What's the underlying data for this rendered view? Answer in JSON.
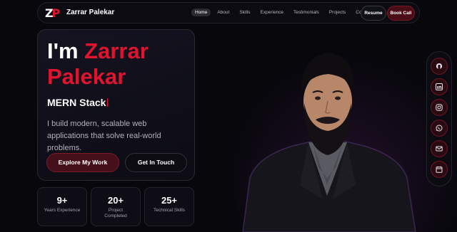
{
  "nav": {
    "logo_z": "Z",
    "logo_p": "P",
    "brand": "Zarrar Palekar",
    "links": [
      "Home",
      "About",
      "Skills",
      "Experience",
      "Testimonials",
      "Projects",
      "Contact"
    ],
    "active_link": "Home",
    "resume_label": "Resume",
    "book_call_label": "Book Call"
  },
  "hero": {
    "title_prefix": "I'm ",
    "title_first": "Zarrar",
    "title_second": "Palekar",
    "role": "MERN Stack",
    "description": "I build modern, scalable web applications that solve real-world problems.",
    "explore_label": "Explore My Work",
    "touch_label": "Get In Touch"
  },
  "stats": [
    {
      "value": "9+",
      "label": "Years Experience"
    },
    {
      "value": "20+",
      "label": "Project Completed"
    },
    {
      "value": "25+",
      "label": "Technical Skills"
    }
  ],
  "social": [
    "github-icon",
    "linkedin-icon",
    "instagram-icon",
    "whatsapp-icon",
    "mail-icon",
    "calendar-icon"
  ],
  "colors": {
    "accent": "#e0142f",
    "background": "#07070c",
    "card": "#141320"
  }
}
